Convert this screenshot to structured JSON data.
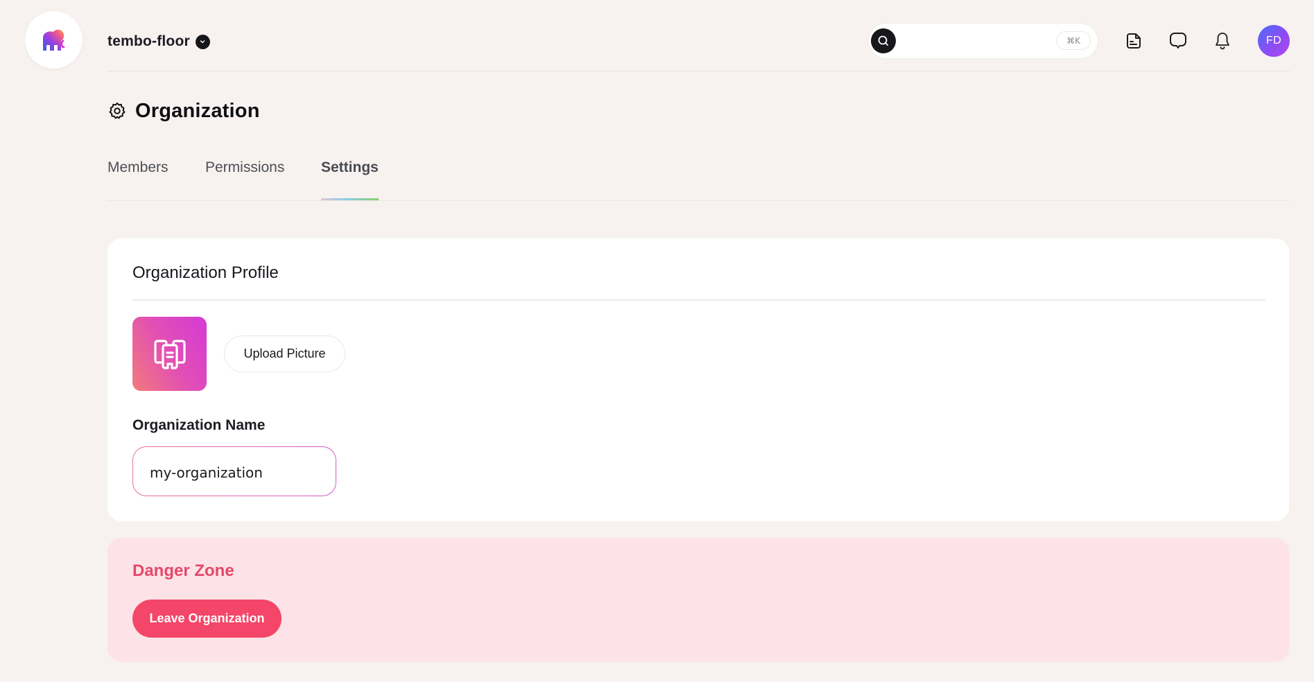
{
  "header": {
    "logo_icon": "elephant-logo-icon",
    "org_name": "tembo-floor",
    "org_switcher_icon": "chevron-down-icon",
    "search": {
      "icon": "search-icon",
      "placeholder": "",
      "value": "",
      "shortcut": "⌘K"
    },
    "icons": [
      "document-icon",
      "chat-icon",
      "bell-icon"
    ],
    "avatar_initials": "FD",
    "avatar_gradient": [
      "#4c6ef8",
      "#b648ee"
    ]
  },
  "page": {
    "icon": "gear-icon",
    "title": "Organization"
  },
  "tabs": [
    {
      "label": "Members",
      "active": false
    },
    {
      "label": "Permissions",
      "active": false
    },
    {
      "label": "Settings",
      "active": true
    }
  ],
  "profile": {
    "title": "Organization Profile",
    "picture_icon": "organization-building-icon",
    "upload_label": "Upload Picture",
    "name_label": "Organization Name",
    "name_value": "my-organization",
    "name_placeholder": ""
  },
  "danger": {
    "title": "Danger Zone",
    "leave_label": "Leave Organization",
    "accent": "#f44668"
  },
  "colors": {
    "background": "#f7f2ef",
    "card": "#ffffff",
    "danger_bg": "#fde3e7",
    "danger_text": "#e5486a"
  }
}
